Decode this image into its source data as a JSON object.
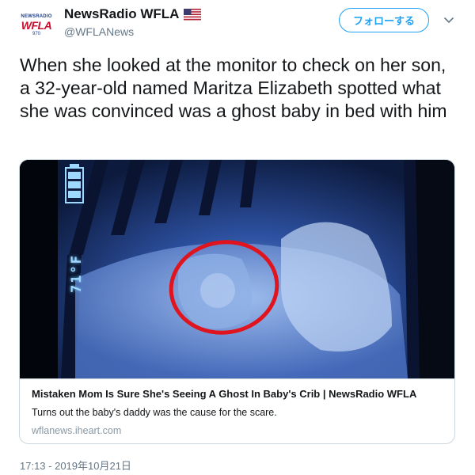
{
  "account": {
    "logo_top": "NEWSRADIO",
    "logo_main": "WFLA",
    "logo_sub": "970",
    "display_name": "NewsRadio WFLA",
    "flag": "us-flag-icon",
    "handle": "@WFLANews"
  },
  "actions": {
    "follow_label": "フォローする",
    "more_icon": "chevron-down-icon"
  },
  "tweet": {
    "text": "When she looked at the monitor to check on her son, a 32-year-old named Maritza Elizabeth spotted what she was convinced was a ghost baby in bed with him"
  },
  "card": {
    "image_overlay_text": "71°F",
    "title": "Mistaken Mom Is Sure She's Seeing A Ghost In Baby's Crib | NewsRadio WFLA",
    "description": "Turns out the baby's daddy was the cause for the scare.",
    "domain": "wflanews.iheart.com",
    "highlight_color": "#e0141e"
  },
  "timestamp": "17:13 - 2019年10月21日",
  "colors": {
    "accent": "#1da1f2",
    "secondary_text": "#657786",
    "border": "#ccd6dd"
  }
}
